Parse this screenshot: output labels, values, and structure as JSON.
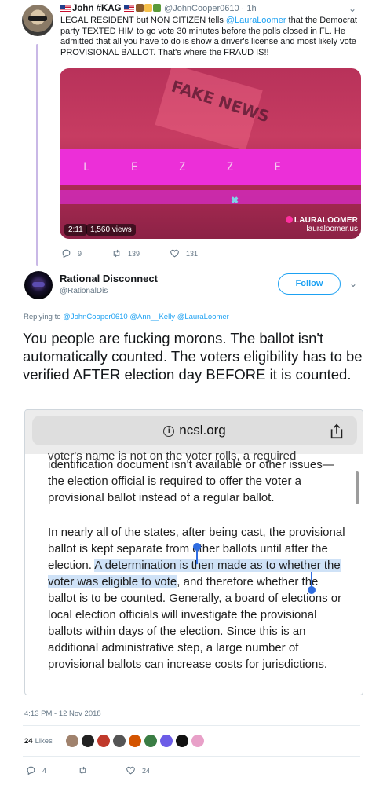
{
  "parent_tweet": {
    "display_name": "John #KAG",
    "handle": "@JohnCooper0610",
    "age": "1h",
    "text_parts": {
      "before": "LEGAL RESIDENT but NON CITIZEN tells ",
      "mention": "@LauraLoomer",
      "after": " that the Democrat party TEXTED HIM to go vote 30 minutes before the polls closed in FL.  He admitted that all you have to do is show a driver's license and most likely vote PROVISIONAL BALLOT.  That's where the FRAUD IS!!"
    },
    "video": {
      "overlay_text": "FAKE NEWS",
      "band_marks": "L E Z Z E",
      "duration": "2:11",
      "views": "1,560 views",
      "watermark_brand": "LAURALOOMER",
      "watermark_site": "lauraloomer.us"
    },
    "replies": "9",
    "retweets": "139",
    "likes": "131"
  },
  "main_tweet": {
    "display_name": "Rational Disconnect",
    "handle": "@RationalDis",
    "follow_label": "Follow",
    "replying_label": "Replying to",
    "replying_mentions": "@JohnCooper0610 @Ann__Kelly @LauraLoomer",
    "text": "You people are fucking morons. The ballot isn't automatically counted. The voters eligibility has to be verified AFTER election day BEFORE it is counted.",
    "timestamp": "4:13 PM - 12 Nov 2018",
    "likes_count": "24",
    "likes_label": "Likes",
    "reply_count": "4",
    "retweet_count": "",
    "like_count": "24"
  },
  "embedded_screenshot": {
    "url": "ncsl.org",
    "cut_line": "voter's name is not on the voter rolls, a required",
    "para1": "identification document isn't available or other issues—the election official is required to offer the voter a provisional ballot instead of a regular ballot.",
    "para2_before": "In nearly all of the states, after being cast, the provisional ballot is kept separate from other ballots until after the election. ",
    "para2_highlight": "A determination is then made as to whether the voter was eligible to vote",
    "para2_after": ", and therefore whether the ballot is to be counted. Generally, a board of elections or local election officials will investigate the provisional ballots within days of the election. Since this is an additional administrative step, a large number of provisional ballots can increase costs for jurisdictions."
  },
  "colors": {
    "link": "#1da1f2",
    "muted": "#657786",
    "thread_line": "#c9b8e6",
    "highlight": "#cfe2f7",
    "selection_handle": "#2f6de1"
  }
}
